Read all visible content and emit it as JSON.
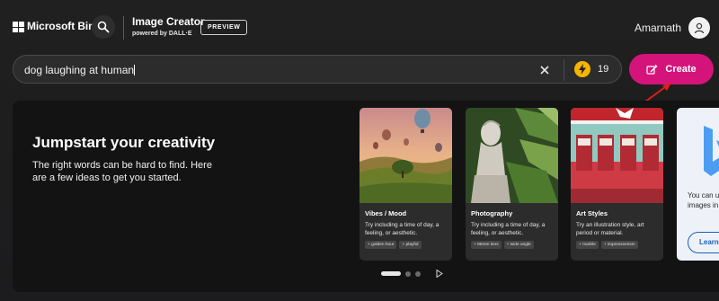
{
  "header": {
    "brand": "Microsoft Bing",
    "product_title": "Image Creator",
    "product_subtitle": "powered by DALL·E",
    "preview_badge": "PREVIEW",
    "user_name": "Amarnath"
  },
  "search": {
    "value": "dog laughing at human",
    "boost_count": "19",
    "create_label": "Create"
  },
  "panel": {
    "title": "Jumpstart your creativity",
    "description": "The right words can be hard to find. Here are a few ideas to get you started.",
    "cards": [
      {
        "title": "Vibes / Mood",
        "description": "Try including a time of day, a feeling, or aesthetic.",
        "chips": [
          "golden hour",
          "playful"
        ]
      },
      {
        "title": "Photography",
        "description": "Try including a time of day, a feeling, or aesthetic.",
        "chips": [
          "85mm lens",
          "wide angle"
        ]
      },
      {
        "title": "Art Styles",
        "description": "Try an illustration style, art period or material.",
        "chips": [
          "marble",
          "impressionism"
        ]
      }
    ],
    "partial_card": {
      "text_line1": "You can u",
      "text_line2": "images in",
      "button_label": "Learn"
    }
  },
  "colors": {
    "accent": "#d5147b",
    "boost": "#f5b400",
    "background": "#1f1f1f",
    "panel": "#131314"
  }
}
